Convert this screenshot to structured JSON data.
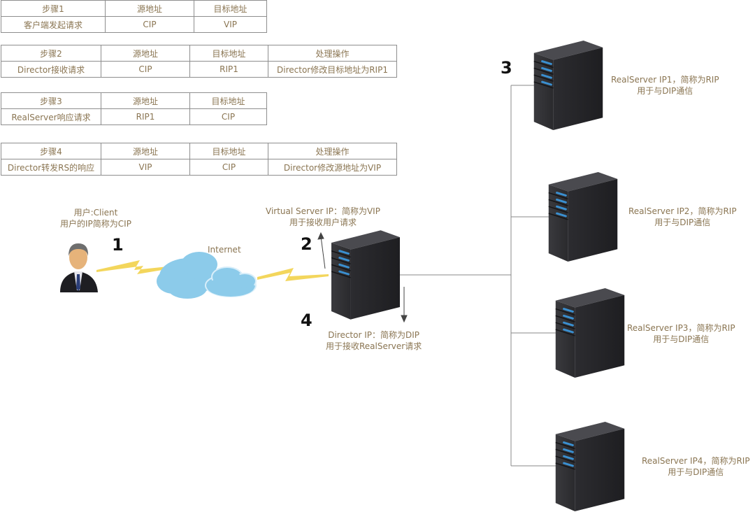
{
  "tables": [
    {
      "header": [
        "步骤1",
        "源地址",
        "目标地址"
      ],
      "row": [
        "客户端发起请求",
        "CIP",
        "VIP"
      ]
    },
    {
      "header": [
        "步骤2",
        "源地址",
        "目标地址",
        "处理操作"
      ],
      "row": [
        "Director接收请求",
        "CIP",
        "RIP1",
        "Director修改目标地址为RIP1"
      ]
    },
    {
      "header": [
        "步骤3",
        "源地址",
        "目标地址"
      ],
      "row": [
        "RealServer响应请求",
        "RIP1",
        "CIP"
      ]
    },
    {
      "header": [
        "步骤4",
        "源地址",
        "目标地址",
        "处理操作"
      ],
      "row": [
        "Director转发RS的响应",
        "VIP",
        "CIP",
        "Director修改源地址为VIP"
      ]
    }
  ],
  "client": {
    "line1": "用户:Client",
    "line2": "用户的IP简称为CIP"
  },
  "internet_label": "Internet",
  "director": {
    "vip_line1": "Virtual  Server  IP：简称为VIP",
    "vip_line2": "用于接收用户请求",
    "dip_line1": "Director  IP：简称为DIP",
    "dip_line2": "用于接收RealServer请求"
  },
  "step_numbers": [
    "1",
    "2",
    "3",
    "4"
  ],
  "real_servers": [
    {
      "line1": "RealServer IP1，简称为RIP",
      "line2": "用于与DIP通信"
    },
    {
      "line1": "RealServer IP2，简称为RIP",
      "line2": "用于与DIP通信"
    },
    {
      "line1": "RealServer IP3，简称为RIP",
      "line2": "用于与DIP通信"
    },
    {
      "line1": "RealServer IP4，简称为RIP",
      "line2": "用于与DIP通信"
    }
  ],
  "colors": {
    "text": "#8a7552",
    "server_body": "#2f2f33",
    "server_led": "#3a8fd0",
    "cloud": "#8ccbea",
    "lightning": "#f2d24a",
    "line": "#888888"
  }
}
